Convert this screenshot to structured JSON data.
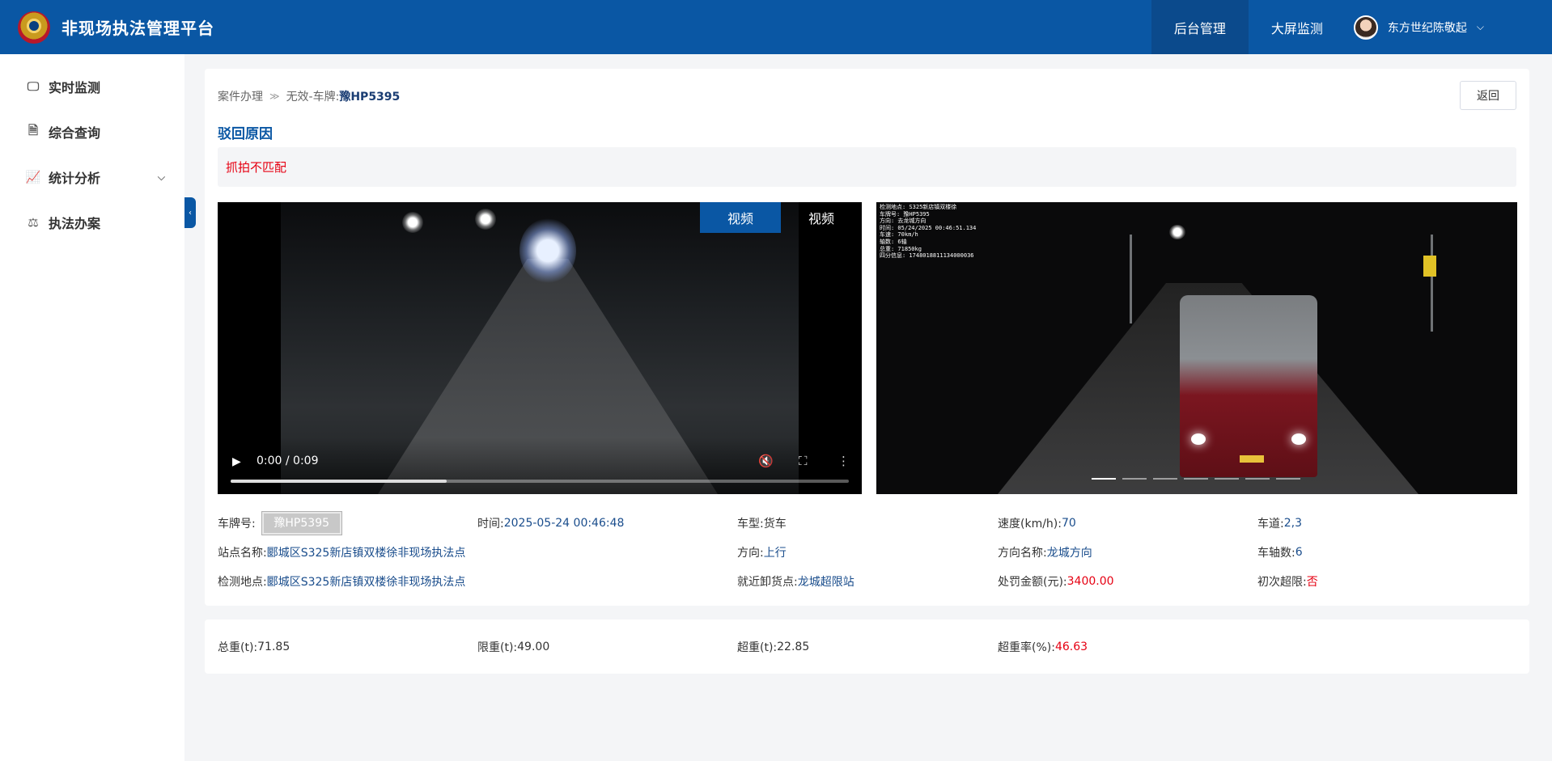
{
  "header": {
    "app_title": "非现场执法管理平台",
    "nav": [
      "后台管理",
      "大屏监测"
    ],
    "active_nav": "后台管理",
    "user_name": "东方世纪陈敬起",
    "brand_color": "#0a57a4"
  },
  "sidebar": {
    "items": [
      {
        "label": "实时监测",
        "icon": "monitor-icon"
      },
      {
        "label": "综合查询",
        "icon": "document-search-icon"
      },
      {
        "label": "统计分析",
        "icon": "line-chart-icon",
        "expandable": true
      },
      {
        "label": "执法办案",
        "icon": "stamp-icon"
      }
    ],
    "collapse_glyph": "‹"
  },
  "breadcrumb": {
    "root": "案件办理",
    "sep": "≫",
    "current_prefix": "无效-车牌:",
    "current_plate": "豫HP5395"
  },
  "actions": {
    "back_label": "返回"
  },
  "reject": {
    "title": "驳回原因",
    "reason": "抓拍不匹配"
  },
  "video": {
    "tabs": [
      "视频",
      "视频"
    ],
    "active_tab_index": 0,
    "time_display": "0:00 / 0:09",
    "progress_fraction": 0.35
  },
  "capture_overlay": {
    "lines": [
      "检测地点:  S325新店镇双楼徐",
      "车牌号:    豫HP5395",
      "方向:      去龙城方向",
      "时间:      05/24/2025 00:46:51.134",
      "车速:      70km/h",
      "轴数:      6轴",
      "总重:      71850kg",
      "四分信息:  1748018811134000036"
    ],
    "slides": 7,
    "active_slide_index": 0
  },
  "info": {
    "plate_label": "车牌号:",
    "plate_value": "豫HP5395",
    "time_label": "时间:",
    "time_value": "2025-05-24 00:46:48",
    "vehicle_type_label": "车型:",
    "vehicle_type_value": "货车",
    "speed_label": "速度(km/h):",
    "speed_value": "70",
    "lane_label": "车道:",
    "lane_value": "2,3",
    "station_label": "站点名称:",
    "station_value": "郾城区S325新店镇双楼徐非现场执法点",
    "direction_label": "方向:",
    "direction_value": "上行",
    "direction_name_label": "方向名称:",
    "direction_name_value": "龙城方向",
    "axles_label": "车轴数:",
    "axles_value": "6",
    "detect_site_label": "检测地点:",
    "detect_site_value": "郾城区S325新店镇双楼徐非现场执法点",
    "unload_label": "就近卸货点:",
    "unload_value": "龙城超限站",
    "fine_label": "处罚金额(元):",
    "fine_value": "3400.00",
    "first_over_label": "初次超限:",
    "first_over_value": "否"
  },
  "weights": {
    "total_label": "总重(t):",
    "total_value": "71.85",
    "limit_label": "限重(t):",
    "limit_value": "49.00",
    "over_label": "超重(t):",
    "over_value": "22.85",
    "rate_label": "超重率(%):",
    "rate_value": "46.63"
  }
}
